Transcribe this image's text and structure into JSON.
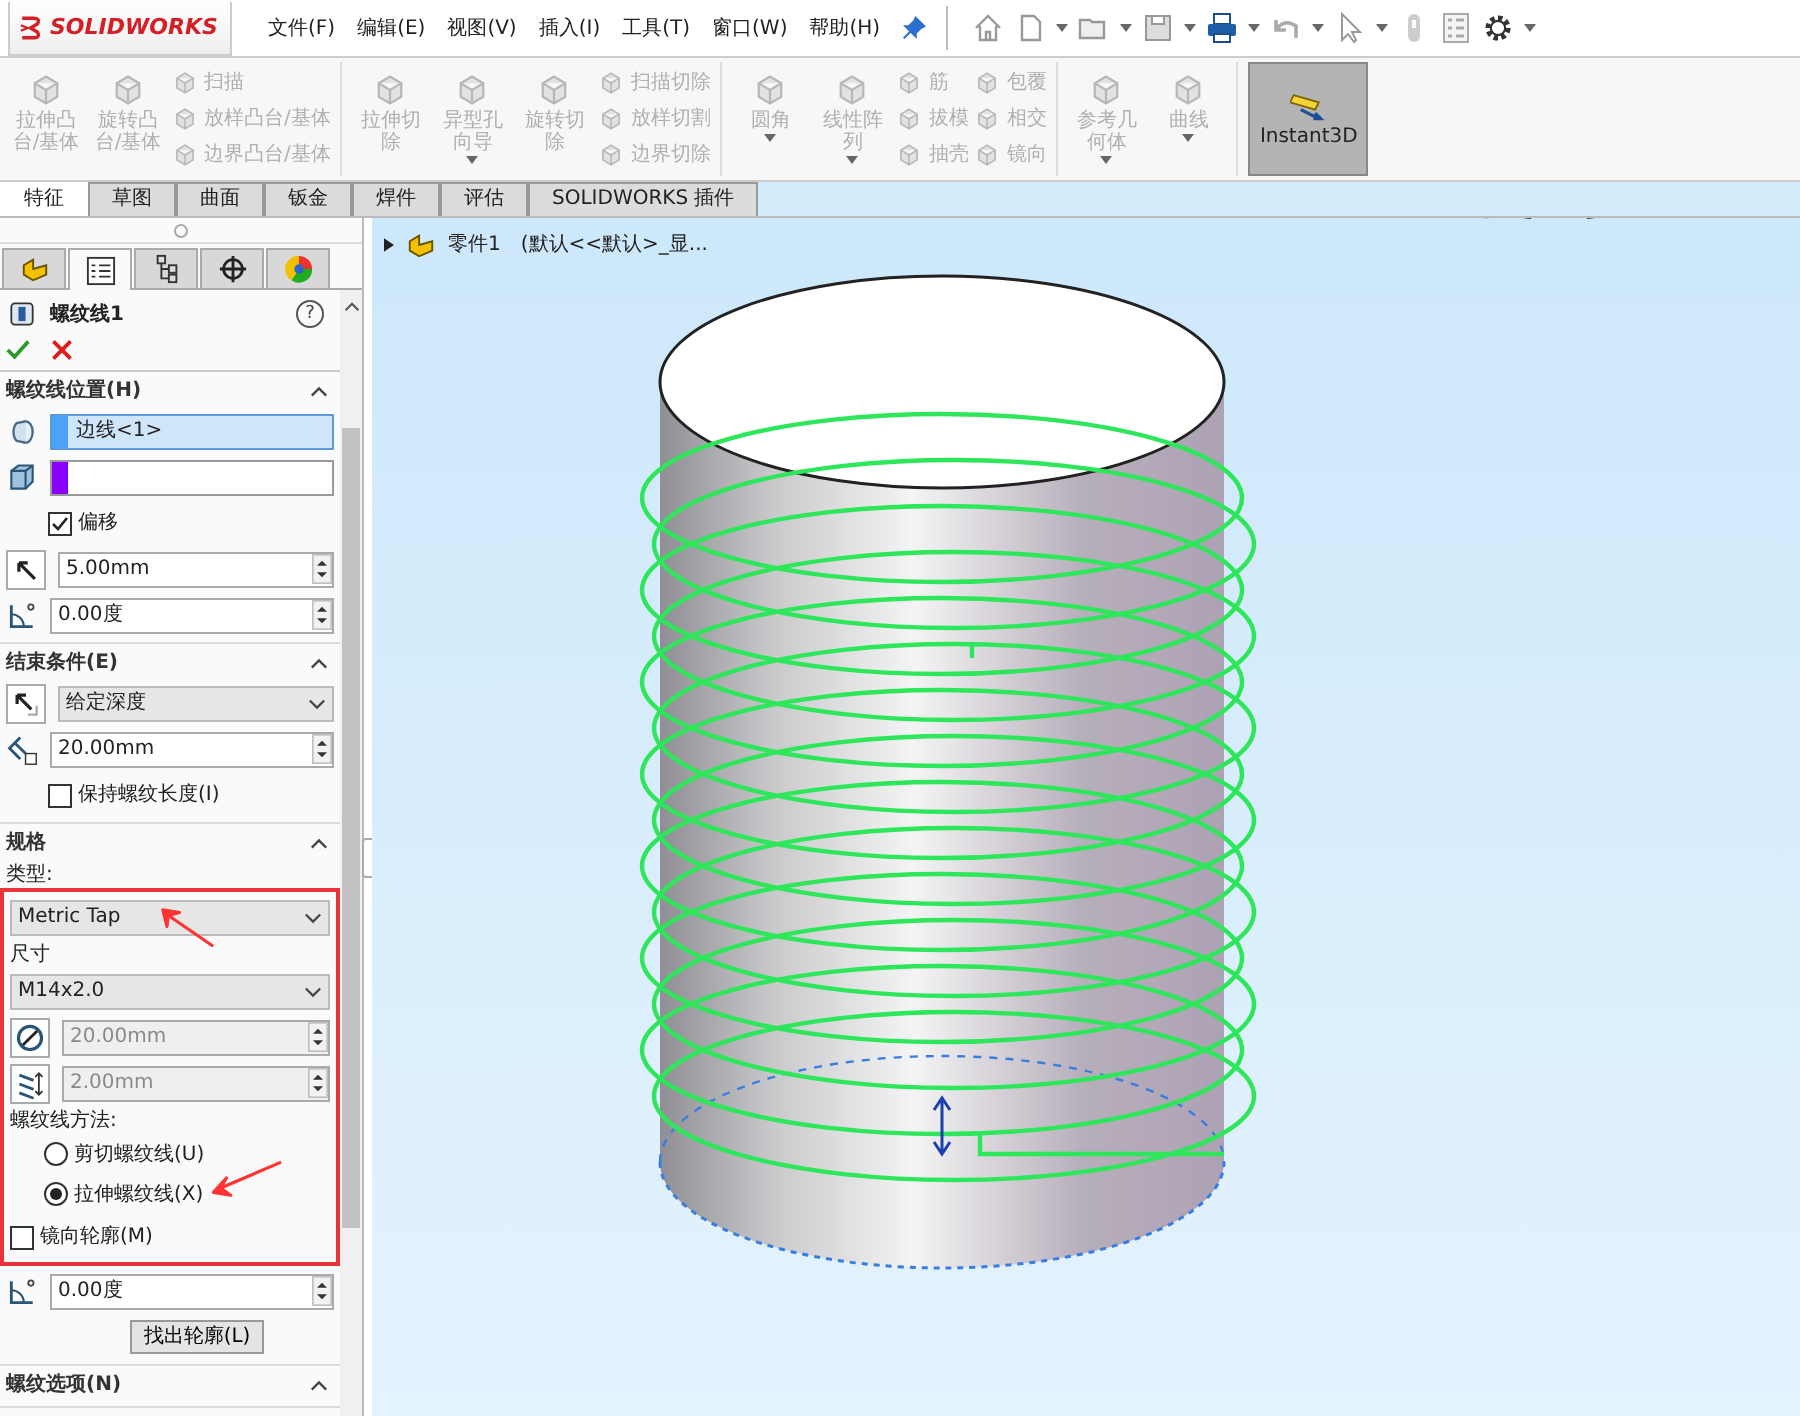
{
  "app": {
    "logo": "SOLIDWORKS"
  },
  "menu": [
    {
      "label": "文件(F)"
    },
    {
      "label": "编辑(E)"
    },
    {
      "label": "视图(V)"
    },
    {
      "label": "插入(I)"
    },
    {
      "label": "工具(T)"
    },
    {
      "label": "窗口(W)"
    },
    {
      "label": "帮助(H)"
    }
  ],
  "ribbon": {
    "groups": [
      {
        "large": [
          {
            "label": "拉伸凸台/基体",
            "disabled": true,
            "active": false,
            "menu": false
          },
          {
            "label": "旋转凸台/基体",
            "disabled": true,
            "active": false,
            "menu": false
          }
        ],
        "small_columns": [
          [
            {
              "label": "扫描",
              "disabled": true
            },
            {
              "label": "放样凸台/基体",
              "disabled": true
            },
            {
              "label": "边界凸台/基体",
              "disabled": true
            }
          ]
        ]
      },
      {
        "large": [
          {
            "label": "拉伸切除",
            "disabled": true,
            "active": false,
            "menu": false
          },
          {
            "label": "异型孔向导",
            "disabled": true,
            "active": false,
            "menu": true
          },
          {
            "label": "旋转切除",
            "disabled": true,
            "active": false,
            "menu": false
          }
        ],
        "small_columns": [
          [
            {
              "label": "扫描切除",
              "disabled": true
            },
            {
              "label": "放样切割",
              "disabled": true
            },
            {
              "label": "边界切除",
              "disabled": true
            }
          ]
        ]
      },
      {
        "large": [
          {
            "label": "圆角",
            "disabled": true,
            "active": false,
            "menu": true
          },
          {
            "label": "线性阵列",
            "disabled": true,
            "active": false,
            "menu": true
          }
        ],
        "small_columns": [
          [
            {
              "label": "筋",
              "disabled": true
            },
            {
              "label": "拔模",
              "disabled": true
            },
            {
              "label": "抽壳",
              "disabled": true
            }
          ],
          [
            {
              "label": "包覆",
              "disabled": true
            },
            {
              "label": "相交",
              "disabled": true
            },
            {
              "label": "镜向",
              "disabled": true
            }
          ]
        ]
      },
      {
        "large": [
          {
            "label": "参考几何体",
            "disabled": true,
            "active": false,
            "menu": true
          },
          {
            "label": "曲线",
            "disabled": true,
            "active": false,
            "menu": true
          }
        ]
      },
      {
        "large": [
          {
            "label": "Instant3D",
            "disabled": false,
            "active": true,
            "menu": false
          }
        ]
      }
    ]
  },
  "tabs": [
    {
      "label": "特征",
      "selected": true
    },
    {
      "label": "草图",
      "selected": false
    },
    {
      "label": "曲面",
      "selected": false
    },
    {
      "label": "钣金",
      "selected": false
    },
    {
      "label": "焊件",
      "selected": false
    },
    {
      "label": "评估",
      "selected": false
    },
    {
      "label": "SOLIDWORKS 插件",
      "selected": false
    }
  ],
  "panel": {
    "tabs": [
      {
        "kind": "feature_tree",
        "selected": false
      },
      {
        "kind": "property_manager",
        "selected": true
      },
      {
        "kind": "configuration",
        "selected": false
      },
      {
        "kind": "dimxpert",
        "selected": false
      },
      {
        "kind": "display",
        "selected": false
      }
    ],
    "title": "螺纹线1",
    "help": "?",
    "sections": [
      {
        "title": "螺纹线位置(H)",
        "expanded": true,
        "rows": [
          {
            "kind": "selection_edge",
            "color": "#4da3f5",
            "value": "边线<1>",
            "selected": true
          },
          {
            "kind": "selection_face",
            "color": "#8800ff",
            "selected": false
          },
          {
            "kind": "checkbox",
            "label": "偏移",
            "checked": true
          },
          {
            "kind": "spin_offset",
            "value": "5.00mm",
            "disabled": false
          },
          {
            "kind": "spin_angle",
            "value": "0.00度",
            "disabled": false
          }
        ]
      },
      {
        "title": "结束条件(E)",
        "expanded": true,
        "rows": [
          {
            "kind": "dropdown_end",
            "value": "给定深度",
            "disabled": false
          },
          {
            "kind": "spin_depth",
            "value": "20.00mm",
            "disabled": false
          },
          {
            "kind": "checkbox",
            "label": "保持螺纹长度(I)",
            "checked": false
          }
        ]
      },
      {
        "title": "规格",
        "expanded": true,
        "rows": [
          {
            "kind": "label",
            "label": "类型:"
          }
        ],
        "boxed_rows": [
          {
            "kind": "dropdown",
            "value": "Metric Tap",
            "disabled": false,
            "arrow": true
          },
          {
            "kind": "label",
            "label": "尺寸"
          },
          {
            "kind": "dropdown",
            "value": "M14x2.0",
            "disabled": false,
            "arrow": false
          },
          {
            "kind": "spin_diameter",
            "value": "20.00mm",
            "disabled": true
          },
          {
            "kind": "spin_pitch",
            "value": "2.00mm",
            "disabled": true
          },
          {
            "kind": "label",
            "label": "螺纹线方法:"
          },
          {
            "kind": "radio",
            "label": "剪切螺纹线(U)",
            "selected": false,
            "arrow": false
          },
          {
            "kind": "radio",
            "label": "拉伸螺纹线(X)",
            "selected": true,
            "arrow": true
          },
          {
            "kind": "checkbox_flush",
            "label": "镜向轮廓(M)",
            "checked": false
          }
        ],
        "rows_after": [
          {
            "kind": "spin_angle",
            "value": "0.00度",
            "disabled": false
          },
          {
            "kind": "button",
            "label": "找出轮廓(L)"
          }
        ]
      },
      {
        "title": "螺纹选项(N)",
        "expanded": true
      }
    ]
  },
  "viewport": {
    "tree_root": "零件1",
    "tree_config": "(默认<<默认>_显..."
  }
}
